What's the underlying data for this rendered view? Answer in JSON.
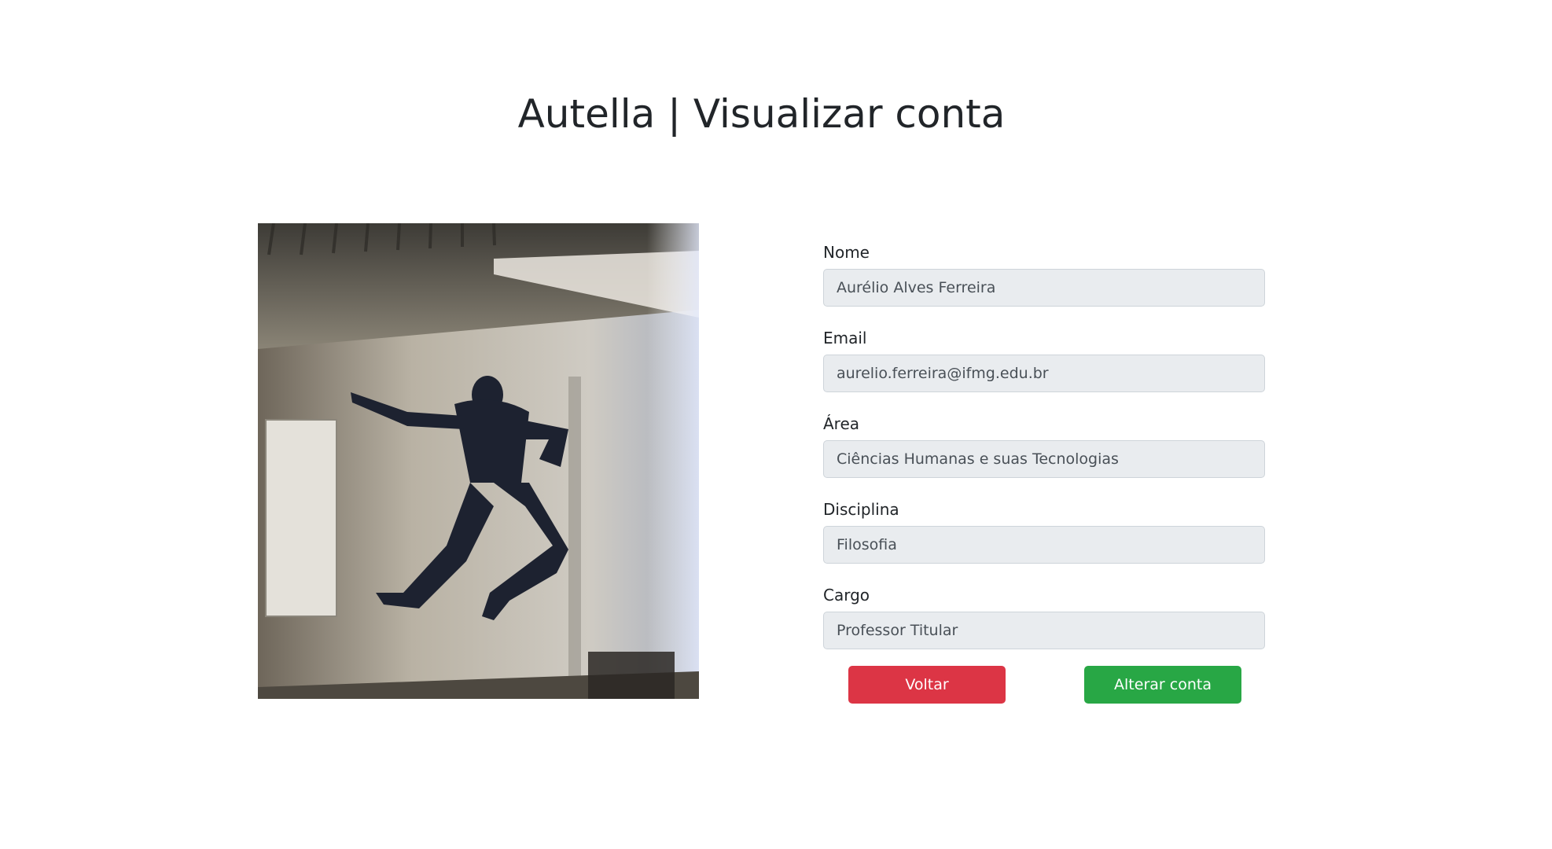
{
  "page": {
    "title": "Autella | Visualizar conta"
  },
  "profile_photo": {
    "description_icon": "profile-photo"
  },
  "form": {
    "fields": [
      {
        "label": "Nome",
        "value": "Aurélio Alves Ferreira"
      },
      {
        "label": "Email",
        "value": "aurelio.ferreira@ifmg.edu.br"
      },
      {
        "label": "Área",
        "value": "Ciências Humanas e suas Tecnologias"
      },
      {
        "label": "Disciplina",
        "value": "Filosofia"
      },
      {
        "label": "Cargo",
        "value": "Professor Titular"
      }
    ]
  },
  "actions": {
    "back_label": "Voltar",
    "edit_label": "Alterar conta"
  },
  "colors": {
    "danger": "#dc3545",
    "success": "#28a745",
    "input_bg": "#e9ecef"
  }
}
